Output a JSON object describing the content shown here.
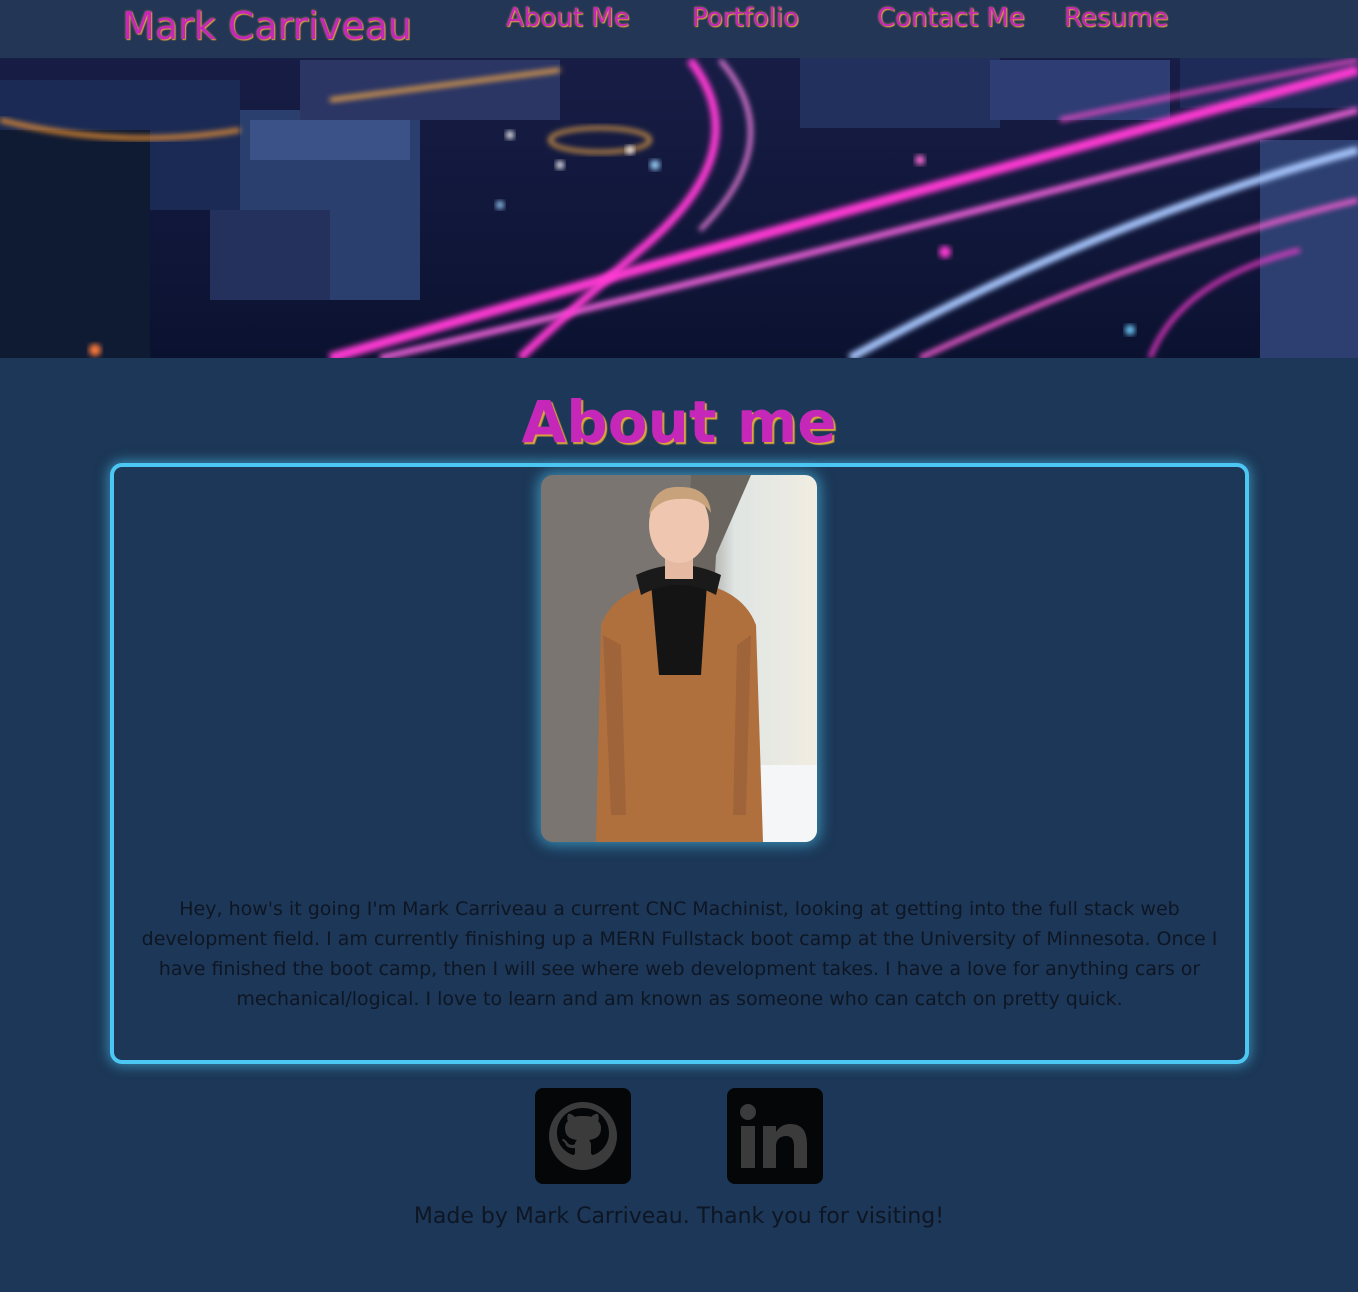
{
  "header": {
    "brand": "Mark Carriveau",
    "nav": [
      {
        "label": "About Me"
      },
      {
        "label": "Portfolio"
      },
      {
        "label": "Contact Me"
      },
      {
        "label": "Resume"
      }
    ]
  },
  "about": {
    "title": "About me",
    "bio": "Hey, how's it going I'm Mark Carriveau a current CNC Machinist, looking at getting into the full stack web development field. I am currently finishing up a MERN Fullstack boot camp at the University of Minnesota. Once I have finished the boot camp, then I will see where web development takes. I have a love for anything cars or mechanical/logical. I love to learn and am known as someone who can catch on pretty quick."
  },
  "social": [
    {
      "icon": "github-icon"
    },
    {
      "icon": "linkedin-icon"
    }
  ],
  "footer": {
    "text": "Made by Mark Carriveau. Thank you for visiting!"
  },
  "colors": {
    "background": "#1c3757",
    "accent_text": "#c528b8",
    "text_shadow": "#d9a63a",
    "card_border": "#4cc6f2"
  }
}
